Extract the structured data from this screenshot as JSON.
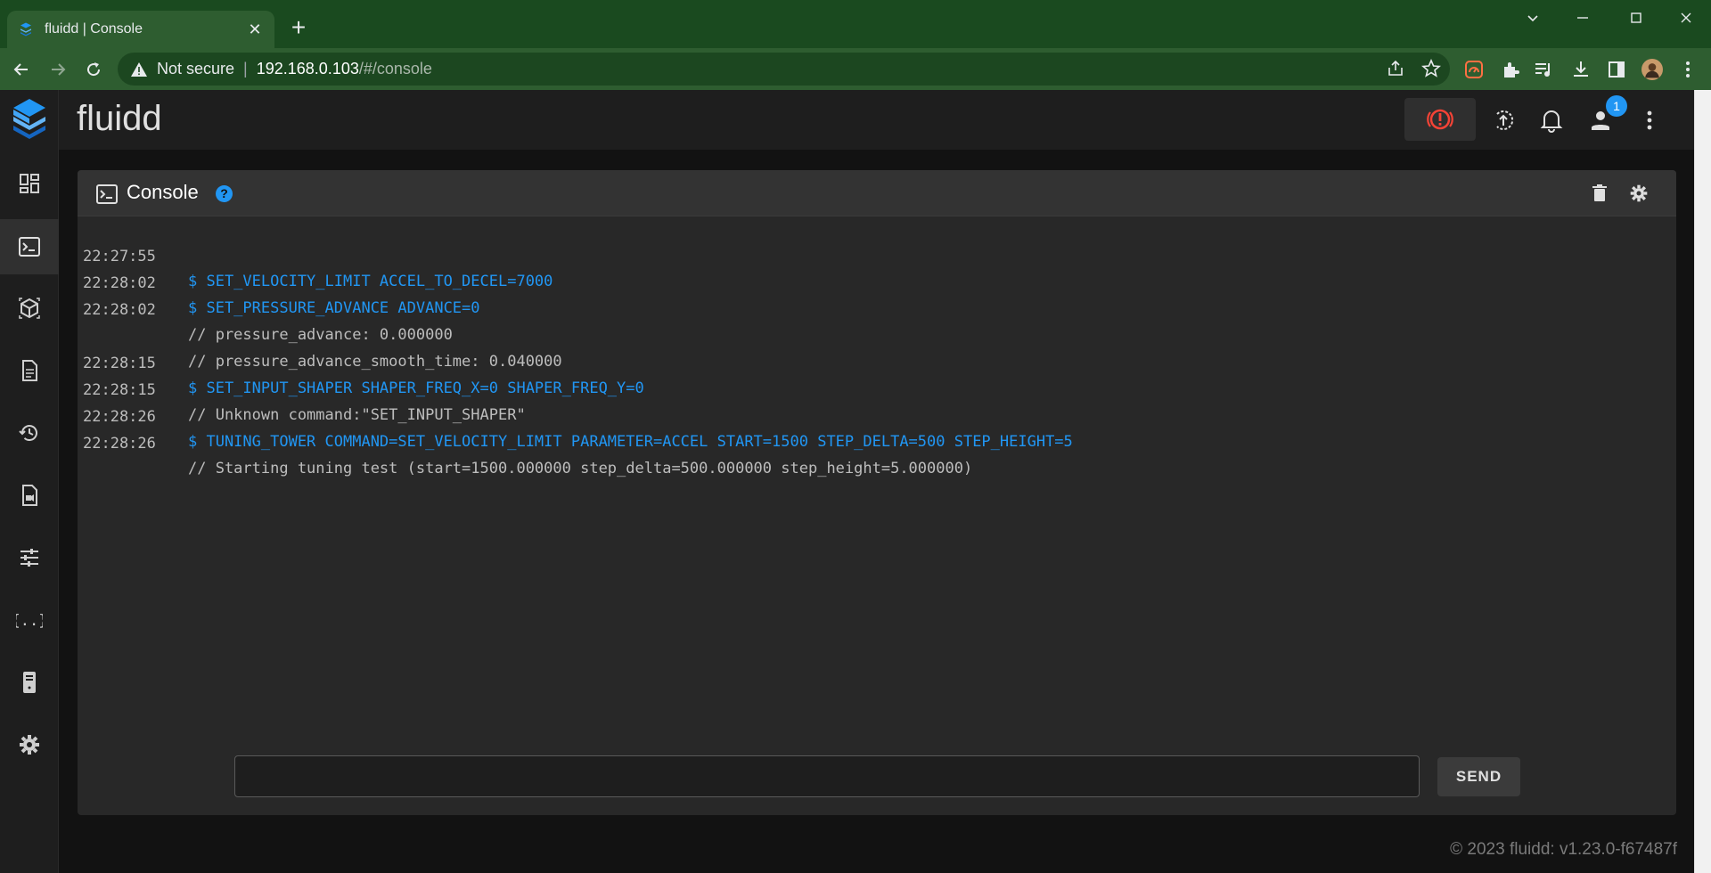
{
  "browser": {
    "tab_title": "fluidd | Console",
    "url_security": "Not secure",
    "url_host": "192.168.0.103",
    "url_path": "/#/console"
  },
  "app": {
    "brand": "fluidd",
    "notification_count": "1",
    "sidebar_items": [
      {
        "name": "dashboard",
        "icon": "dashboard-icon"
      },
      {
        "name": "console",
        "icon": "console-icon",
        "active": true
      },
      {
        "name": "printer-view",
        "icon": "cube-icon"
      },
      {
        "name": "jobs",
        "icon": "file-icon"
      },
      {
        "name": "history",
        "icon": "history-icon"
      },
      {
        "name": "timelapse",
        "icon": "video-file-icon"
      },
      {
        "name": "tune",
        "icon": "tune-icon"
      },
      {
        "name": "configuration",
        "icon": "code-braces-icon"
      },
      {
        "name": "system",
        "icon": "server-icon"
      },
      {
        "name": "settings",
        "icon": "gear-icon"
      }
    ]
  },
  "console": {
    "title": "Console",
    "help_glyph": "?",
    "entries": [
      {
        "time": "22:27:55",
        "text": "$ SET_VELOCITY_LIMIT ACCEL_TO_DECEL=7000",
        "kind": "cmd"
      },
      {
        "time": "22:28:02",
        "text": "$ SET_PRESSURE_ADVANCE ADVANCE=0",
        "kind": "cmd"
      },
      {
        "time": "22:28:02",
        "text": "// pressure_advance: 0.000000",
        "kind": "resp"
      },
      {
        "time": "",
        "text": "// pressure_advance_smooth_time: 0.040000",
        "kind": "resp"
      },
      {
        "time": "22:28:15",
        "text": "$ SET_INPUT_SHAPER SHAPER_FREQ_X=0 SHAPER_FREQ_Y=0",
        "kind": "cmd"
      },
      {
        "time": "22:28:15",
        "text": "// Unknown command:\"SET_INPUT_SHAPER\"",
        "kind": "resp"
      },
      {
        "time": "22:28:26",
        "text": "$ TUNING_TOWER COMMAND=SET_VELOCITY_LIMIT PARAMETER=ACCEL START=1500 STEP_DELTA=500 STEP_HEIGHT=5",
        "kind": "cmd"
      },
      {
        "time": "22:28:26",
        "text": "// Starting tuning test (start=1500.000000 step_delta=500.000000 step_height=5.000000)",
        "kind": "resp"
      }
    ],
    "input_value": "",
    "send_label": "SEND"
  },
  "footer": {
    "text": "© 2023 fluidd: v1.23.0-f67487f"
  },
  "colors": {
    "accent": "#2196f3",
    "estop": "#f44336",
    "chrome_green": "#2e5d30"
  }
}
